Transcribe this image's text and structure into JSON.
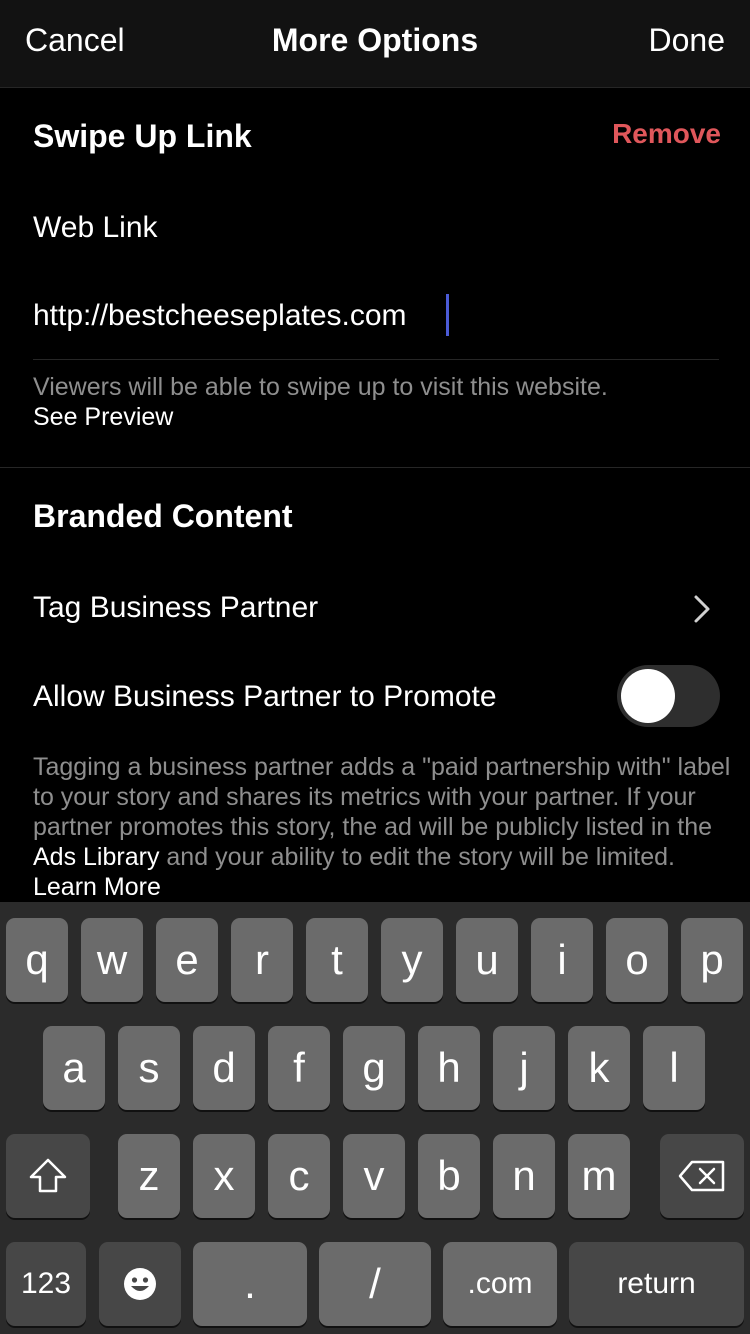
{
  "header": {
    "cancel": "Cancel",
    "title": "More Options",
    "done": "Done"
  },
  "swipe_up": {
    "title": "Swipe Up Link",
    "remove": "Remove",
    "web_link_label": "Web Link",
    "url_value": "http://bestcheeseplates.com",
    "helper_text": "Viewers will be able to swipe up to visit this website.",
    "preview_link": "See Preview"
  },
  "branded": {
    "title": "Branded Content",
    "tag_partner": "Tag Business Partner",
    "allow_promote": "Allow Business Partner to Promote",
    "allow_promote_on": false,
    "note_part1": "Tagging a business partner adds a \"paid partnership with\" label to your story and shares its metrics with your partner. If your partner promotes this story, the ad will be publicly listed in the",
    "ads_library": "Ads Library",
    "note_part2": "and your ability to edit the story will be limited.",
    "learn_more": "Learn More"
  },
  "keyboard": {
    "row1": [
      "q",
      "w",
      "e",
      "r",
      "t",
      "y",
      "u",
      "i",
      "o",
      "p"
    ],
    "row2": [
      "a",
      "s",
      "d",
      "f",
      "g",
      "h",
      "j",
      "k",
      "l"
    ],
    "row3": [
      "z",
      "x",
      "c",
      "v",
      "b",
      "n",
      "m"
    ],
    "numbers": "123",
    "period": ".",
    "slash": "/",
    "dotcom": ".com",
    "return": "return",
    "shift_icon": "shift-icon",
    "delete_icon": "backspace-icon",
    "emoji_icon": "emoji-icon"
  }
}
